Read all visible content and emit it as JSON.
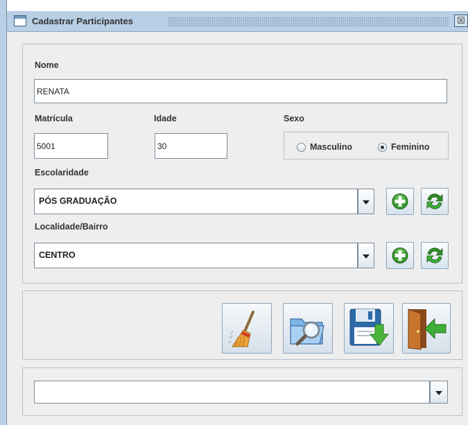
{
  "window": {
    "title": "Cadastrar Participantes",
    "close_glyph": "☒"
  },
  "form": {
    "nome": {
      "label": "Nome",
      "value": "RENATA"
    },
    "matricula": {
      "label": "Matrícula",
      "value": "5001"
    },
    "idade": {
      "label": "Idade",
      "value": "30"
    },
    "sexo": {
      "label": "Sexo",
      "options": [
        {
          "label": "Masculino",
          "checked": false
        },
        {
          "label": "Feminino",
          "checked": true
        }
      ]
    },
    "escolaridade": {
      "label": "Escolaridade",
      "value": "PÓS GRADUAÇÃO"
    },
    "localidade": {
      "label": "Localidade/Bairro",
      "value": "CENTRO"
    }
  },
  "toolbar": {
    "buttons": [
      {
        "name": "clear-button",
        "icon": "broom-icon"
      },
      {
        "name": "search-button",
        "icon": "folder-search-icon"
      },
      {
        "name": "save-button",
        "icon": "save-disk-icon"
      },
      {
        "name": "exit-button",
        "icon": "exit-door-icon"
      }
    ]
  },
  "bottom_combo": {
    "value": ""
  },
  "colors": {
    "titlebar": "#b8cfe5",
    "add_green": "#3d9b33",
    "refresh_green": "#2f8f2a"
  }
}
